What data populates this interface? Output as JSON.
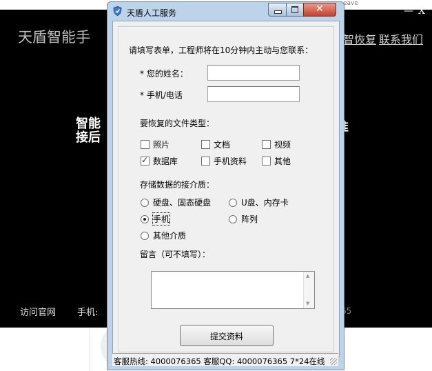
{
  "background": {
    "top_text": "eave",
    "title": "天盾智能手",
    "link_recover": "智恢复",
    "link_contact": "联系我们",
    "close_x": "X",
    "headline_line1": "智能",
    "headline_line2": "接后",
    "headline_right": "准",
    "footer_official": "访问官网",
    "footer_phone": "手机:",
    "footer_right": "65"
  },
  "dialog": {
    "title": "天盾人工服务",
    "instruction": "请填写表单，工程师将在10分钟内主动与您联系：",
    "name_label": "* 您的姓名：",
    "name_value": "",
    "phone_label": "* 手机/电话",
    "phone_value": "",
    "filetype_heading": "要恢复的文件类型：",
    "filetypes": [
      {
        "label": "照片",
        "checked": false
      },
      {
        "label": "文档",
        "checked": false
      },
      {
        "label": "视频",
        "checked": false
      },
      {
        "label": "数据库",
        "checked": true
      },
      {
        "label": "手机资料",
        "checked": false
      },
      {
        "label": "其他",
        "checked": false
      }
    ],
    "media_heading": "存储数据的接介质：",
    "media": [
      {
        "label": "硬盘、固态硬盘",
        "checked": false
      },
      {
        "label": "U盘、内存卡",
        "checked": false
      },
      {
        "label": "手机",
        "checked": true
      },
      {
        "label": "阵列",
        "checked": false
      },
      {
        "label": "其他介质",
        "checked": false
      }
    ],
    "message_label": "留言（可不填写）：",
    "message_value": "",
    "submit_label": "提交资料",
    "status_text": "客服热线: 4000076365 客服QQ: 4000076365 7*24在线"
  }
}
